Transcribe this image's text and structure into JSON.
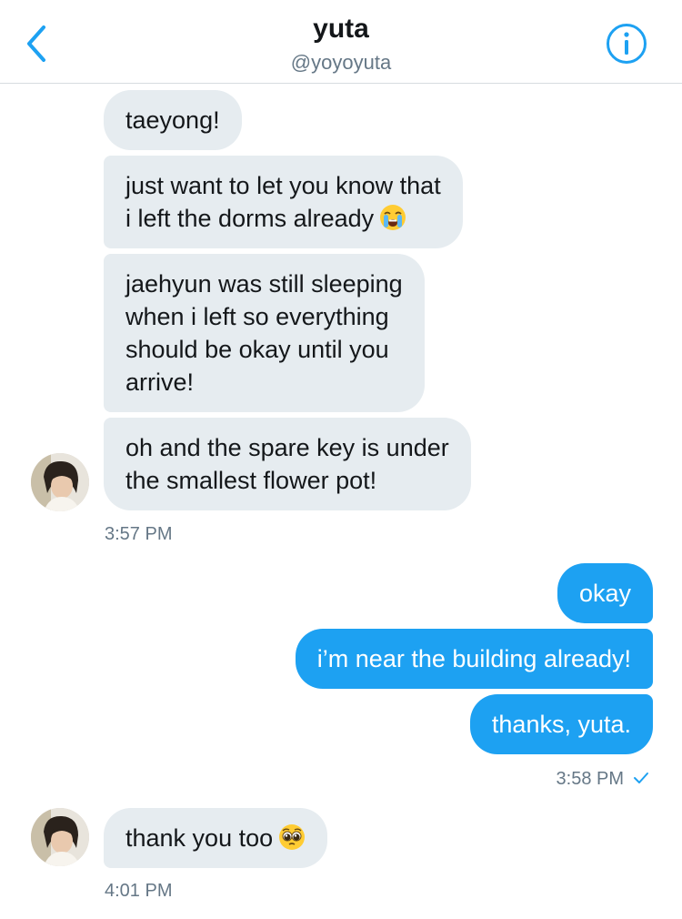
{
  "header": {
    "title": "yuta",
    "handle": "@yoyoyuta"
  },
  "messages": {
    "incoming_group_1": [
      "taeyong!",
      "just want to let you know that\ni left the dorms already",
      "jaehyun was still sleeping\nwhen i left so everything\nshould be okay until you\narrive!",
      "oh and the spare key is under\nthe smallest flower pot!"
    ],
    "incoming_group_1_emoji": "loudly-crying-face-emoji",
    "incoming_group_1_time": "3:57 PM",
    "outgoing_group": [
      "okay",
      "i’m near the building already!",
      "thanks, yuta."
    ],
    "outgoing_group_time": "3:58 PM",
    "outgoing_status": "sent-checkmark",
    "incoming_group_2": [
      "thank you too"
    ],
    "incoming_group_2_emoji": "pleading-face-emoji",
    "incoming_group_2_time": "4:01 PM"
  },
  "colors": {
    "accent": "#1da1f2",
    "incoming_bubble": "#e6ecf0",
    "timestamp": "#657786",
    "header_divider": "#d7dce0"
  }
}
